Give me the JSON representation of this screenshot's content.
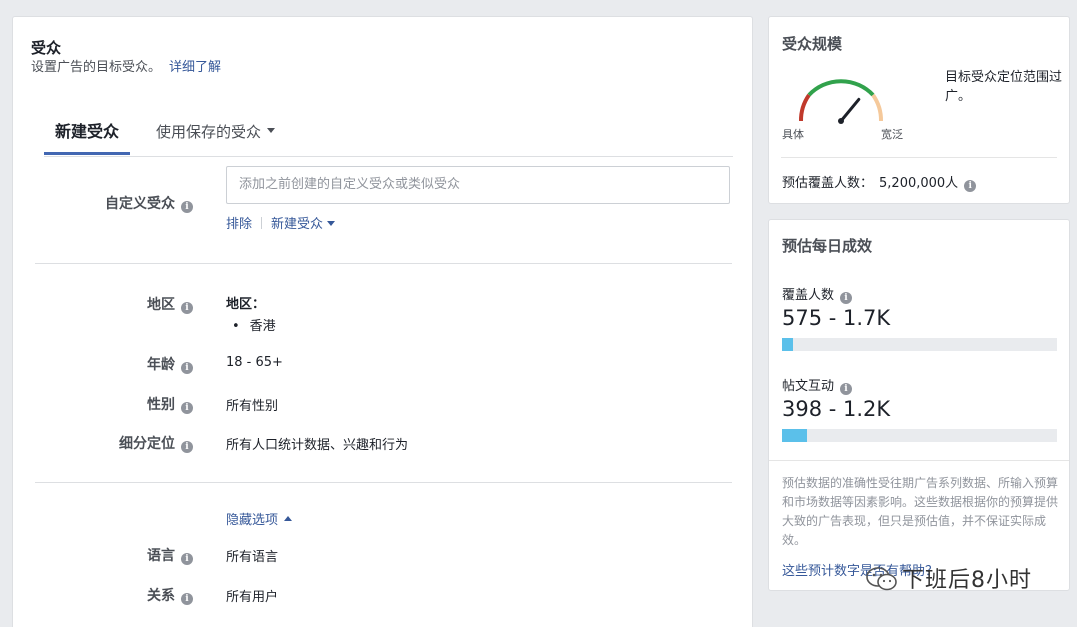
{
  "audience": {
    "title": "受众",
    "subtitle": "设置广告的目标受众。",
    "learn_more": "详细了解",
    "tabs": {
      "new": "新建受众",
      "saved": "使用保存的受众"
    },
    "custom": {
      "label": "自定义受众",
      "placeholder": "添加之前创建的自定义受众或类似受众",
      "exclude": "排除",
      "create_new": "新建受众"
    },
    "location": {
      "label": "地区",
      "heading": "地区：",
      "items": [
        "香港"
      ]
    },
    "age": {
      "label": "年龄",
      "value": "18 - 65+"
    },
    "gender": {
      "label": "性别",
      "value": "所有性别"
    },
    "detailed": {
      "label": "细分定位",
      "value": "所有人口统计数据、兴趣和行为"
    },
    "hide_options": "隐藏选项",
    "language": {
      "label": "语言",
      "value": "所有语言"
    },
    "relationship": {
      "label": "关系",
      "value": "所有用户"
    }
  },
  "audience_size": {
    "title": "受众规模",
    "gauge": {
      "left_label": "具体",
      "right_label": "宽泛",
      "level": 0.72
    },
    "description": "目标受众定位范围过广。",
    "reach_label": "预估覆盖人数：",
    "reach_value": "5,200,000人"
  },
  "daily_results": {
    "title": "预估每日成效",
    "reach": {
      "label": "覆盖人数",
      "value": "575 - 1.7K",
      "fill": 0.04
    },
    "engagement": {
      "label": "帖文互动",
      "value": "398 - 1.2K",
      "fill": 0.09
    },
    "note": "预估数据的准确性受往期广告系列数据、所输入预算和市场数据等因素影响。这些数据根据你的预算提供大致的广告表现，但只是预估值，并不保证实际成效。",
    "help_link": "这些预计数字是否有帮助？"
  },
  "watermark": "下班后8小时",
  "colors": {
    "link": "#365899",
    "tab_underline": "#4267b2",
    "bar_fill": "#5bc0ea",
    "gauge_green": "#31a24c",
    "gauge_red": "#c0392b",
    "gauge_peach": "#f5c99b"
  }
}
